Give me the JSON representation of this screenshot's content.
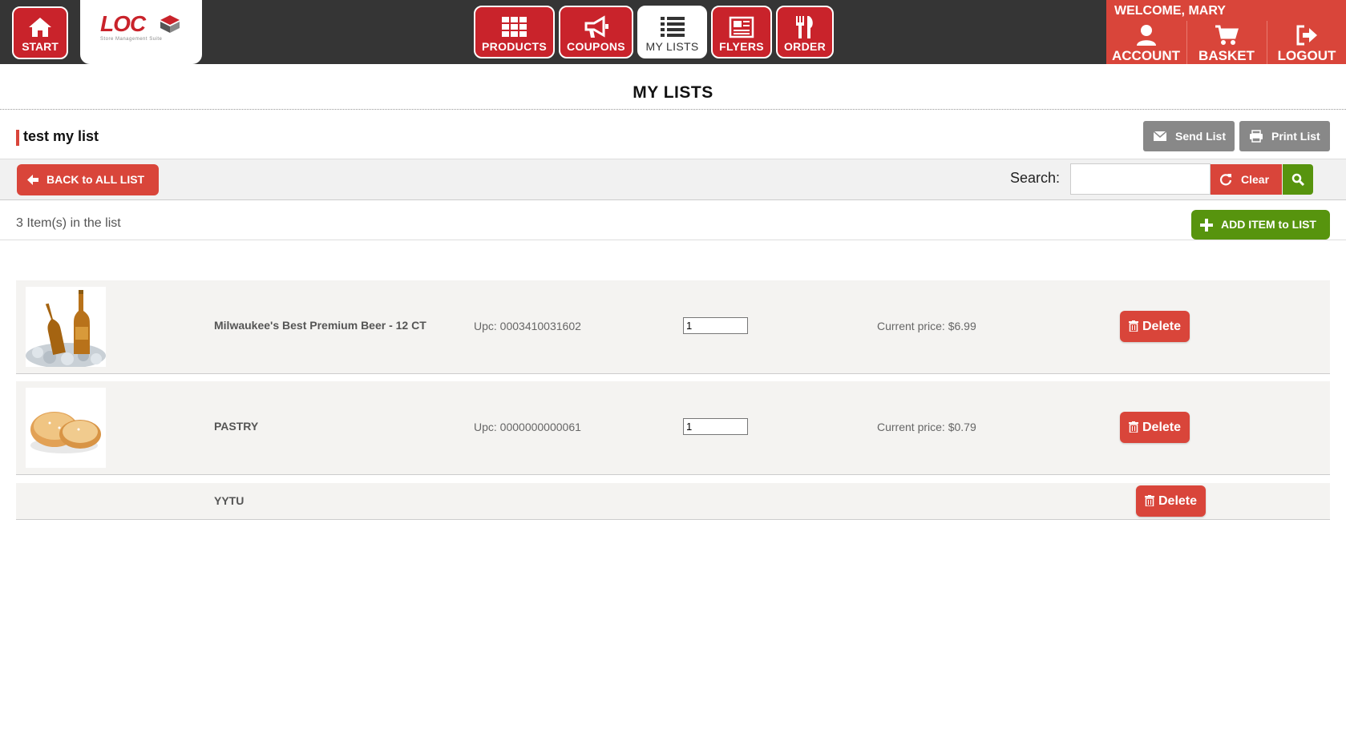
{
  "nav": {
    "start_label": "START",
    "logo_text": "LOC",
    "logo_subtitle": "Store Management Suite",
    "items": [
      {
        "label": "PRODUCTS",
        "icon": "grid-icon"
      },
      {
        "label": "COUPONS",
        "icon": "megaphone-icon"
      },
      {
        "label": "MY LISTS",
        "icon": "list-icon",
        "active": true
      },
      {
        "label": "FLYERS",
        "icon": "newspaper-icon"
      },
      {
        "label": "ORDER",
        "icon": "fork-knife-icon"
      }
    ],
    "welcome": "WELCOME, MARY",
    "user_buttons": [
      {
        "label": "ACCOUNT",
        "icon": "user-icon"
      },
      {
        "label": "BASKET",
        "icon": "cart-icon"
      },
      {
        "label": "LOGOUT",
        "icon": "logout-icon"
      }
    ]
  },
  "page": {
    "title": "MY LISTS",
    "list_name": "test my list",
    "send_list_label": "Send List",
    "print_list_label": "Print List",
    "back_label": "BACK to ALL LIST",
    "search_label": "Search:",
    "search_value": "",
    "clear_label": "Clear",
    "count_text": "3 Item(s) in the list",
    "add_item_label": "ADD ITEM to LIST"
  },
  "items": [
    {
      "name": "Milwaukee's Best Premium Beer - 12 CT",
      "upc": "Upc: 0003410031602",
      "qty": "1",
      "price": "Current price: $6.99",
      "image": "beer-bottles-image",
      "delete_label": "Delete"
    },
    {
      "name": "PASTRY",
      "upc": "Upc: 0000000000061",
      "qty": "1",
      "price": "Current price: $0.79",
      "image": "pastry-image",
      "delete_label": "Delete"
    },
    {
      "name": "YYTU",
      "delete_label": "Delete"
    }
  ],
  "colors": {
    "brand_red": "#c9232b",
    "accent_red": "#d9453a",
    "green": "#57940e",
    "topbar": "#353535",
    "gray_button": "#888888"
  }
}
